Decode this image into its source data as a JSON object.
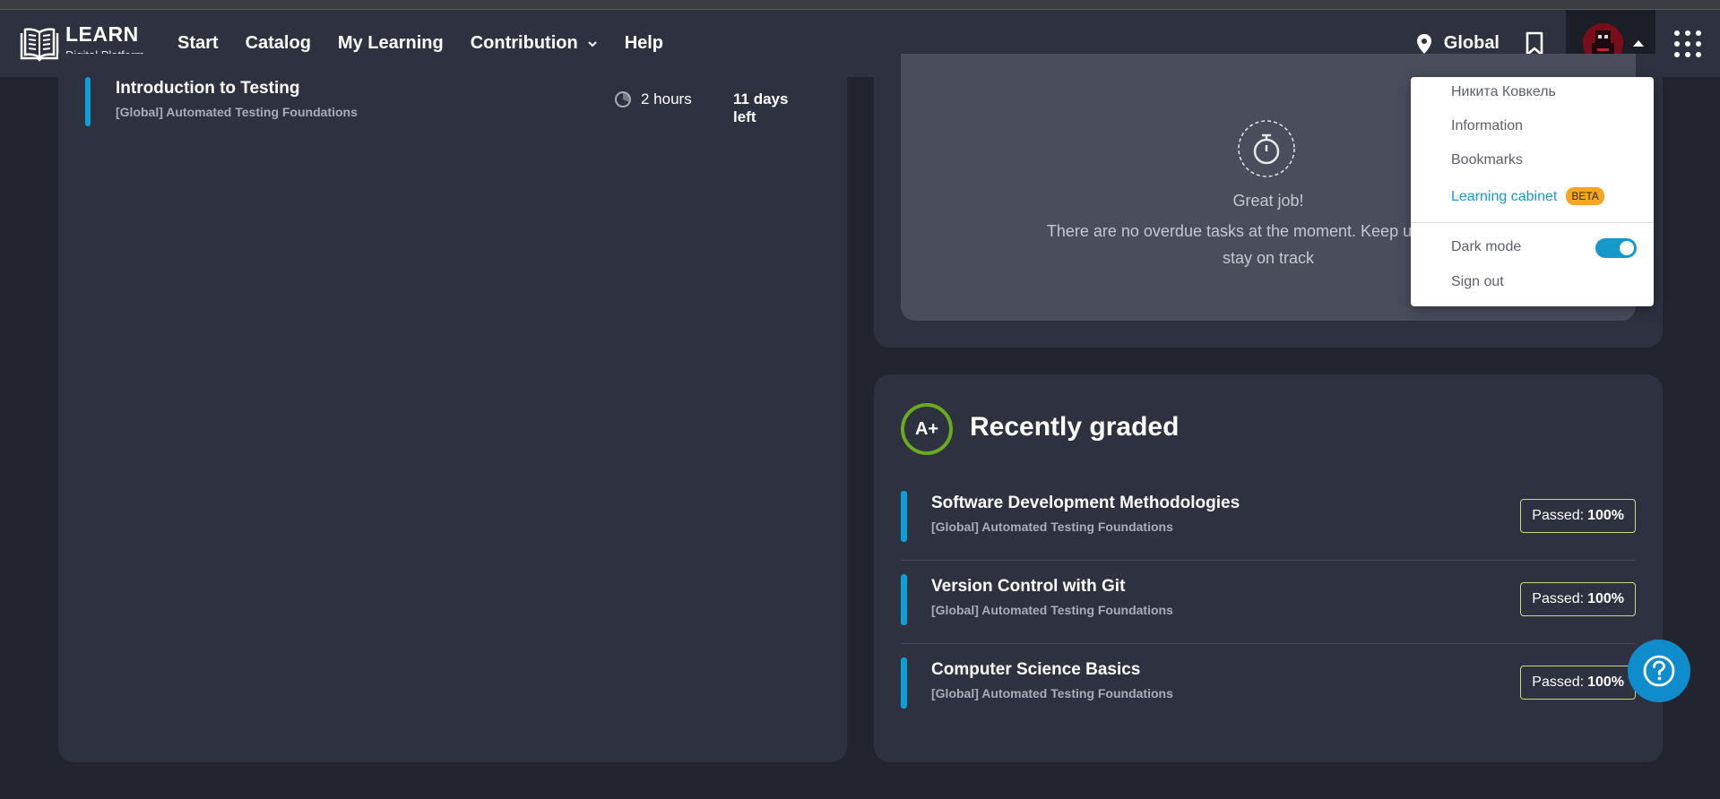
{
  "header": {
    "logo_title": "LEARN",
    "logo_subtitle": "Digital Platform",
    "nav": [
      {
        "label": "Start"
      },
      {
        "label": "Catalog"
      },
      {
        "label": "My Learning"
      },
      {
        "label": "Contribution"
      },
      {
        "label": "Help"
      }
    ],
    "region": "Global",
    "icons": {
      "logo": "book-icon",
      "region": "location-pin-icon",
      "bookmark": "bookmark-icon",
      "apps": "apps-grid-icon"
    }
  },
  "assignment": {
    "title": "Introduction to Testing",
    "subtitle": "[Global] Automated Testing Foundations",
    "duration": "2 hours",
    "deadline": "11 days left"
  },
  "overdue": {
    "title": "Great job!",
    "message_line1": "There are no overdue tasks at the moment. Keep up with your",
    "message_line2": "stay on track"
  },
  "recently_graded": {
    "badge": "A+",
    "title": "Recently graded",
    "items": [
      {
        "title": "Software Development Methodologies",
        "subtitle": "[Global] Automated Testing Foundations",
        "status_label": "Passed:",
        "status_value": "100%"
      },
      {
        "title": "Version Control with Git",
        "subtitle": "[Global] Automated Testing Foundations",
        "status_label": "Passed:",
        "status_value": "100%"
      },
      {
        "title": "Computer Science Basics",
        "subtitle": "[Global] Automated Testing Foundations",
        "status_label": "Passed:",
        "status_value": "100%"
      }
    ]
  },
  "user_menu": {
    "user_name": "Никита Ковкель",
    "items": [
      "Information",
      "Bookmarks",
      "Learning cabinet"
    ],
    "beta_label": "BETA",
    "dark_mode_label": "Dark mode",
    "dark_mode_on": true,
    "sign_out": "Sign out"
  },
  "colors": {
    "accent": "#0e9ed8",
    "background": "#22252f",
    "card": "#2e3140",
    "grade_ring": "#6aaa1e",
    "beta": "#f5a623"
  }
}
